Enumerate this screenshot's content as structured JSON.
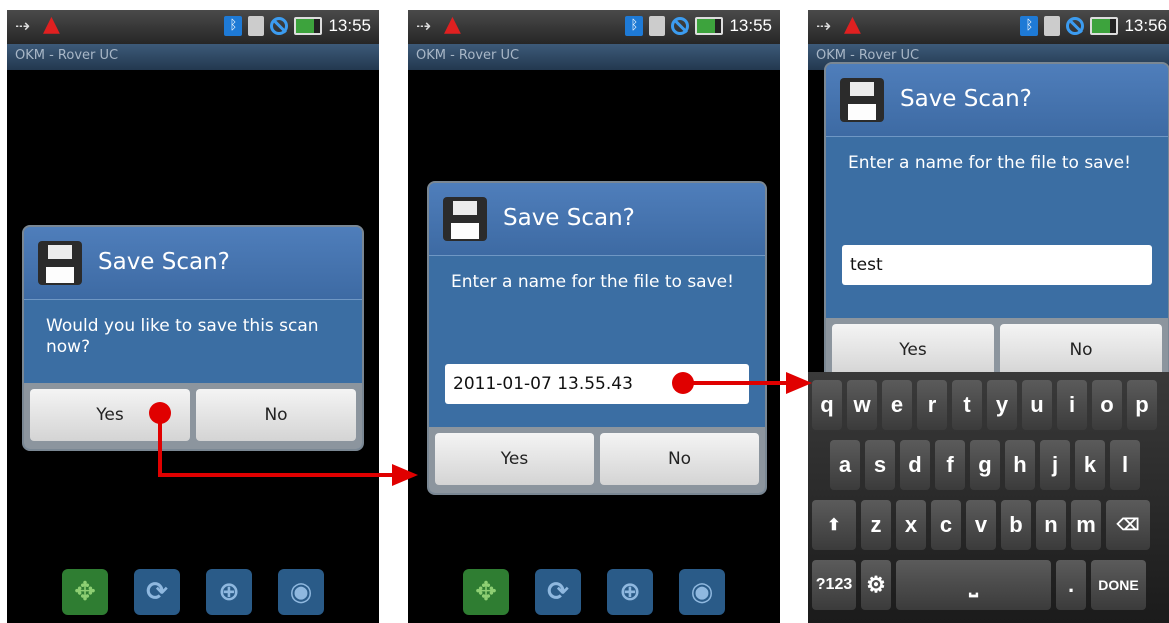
{
  "status_bar": {
    "time_1": "13:55",
    "time_2": "13:55",
    "time_3": "13:56"
  },
  "app": {
    "title": "OKM - Rover UC"
  },
  "toolbar": {
    "icons": [
      "move-icon",
      "rotate-icon",
      "zoom-in-icon",
      "view-icon"
    ]
  },
  "screens": [
    {
      "dialog_title": "Save Scan?",
      "message": "Would you like to save this scan now?",
      "yes": "Yes",
      "no": "No"
    },
    {
      "dialog_title": "Save Scan?",
      "message": "Enter a name for the file to save!",
      "input_value": "2011-01-07 13.55.43",
      "yes": "Yes",
      "no": "No"
    },
    {
      "dialog_title": "Save Scan?",
      "message": "Enter a name for the file to save!",
      "input_value": "test",
      "yes": "Yes",
      "no": "No"
    }
  ],
  "keyboard": {
    "row1": [
      "q",
      "w",
      "e",
      "r",
      "t",
      "y",
      "u",
      "i",
      "o",
      "p"
    ],
    "row2": [
      "a",
      "s",
      "d",
      "f",
      "g",
      "h",
      "j",
      "k",
      "l"
    ],
    "row3": [
      "z",
      "x",
      "c",
      "v",
      "b",
      "n",
      "m"
    ],
    "symbols": "?123",
    "period": ".",
    "done": "DONE"
  },
  "colors": {
    "dialog_blue": "#3b6ea3",
    "annotation_red": "#e00000"
  }
}
